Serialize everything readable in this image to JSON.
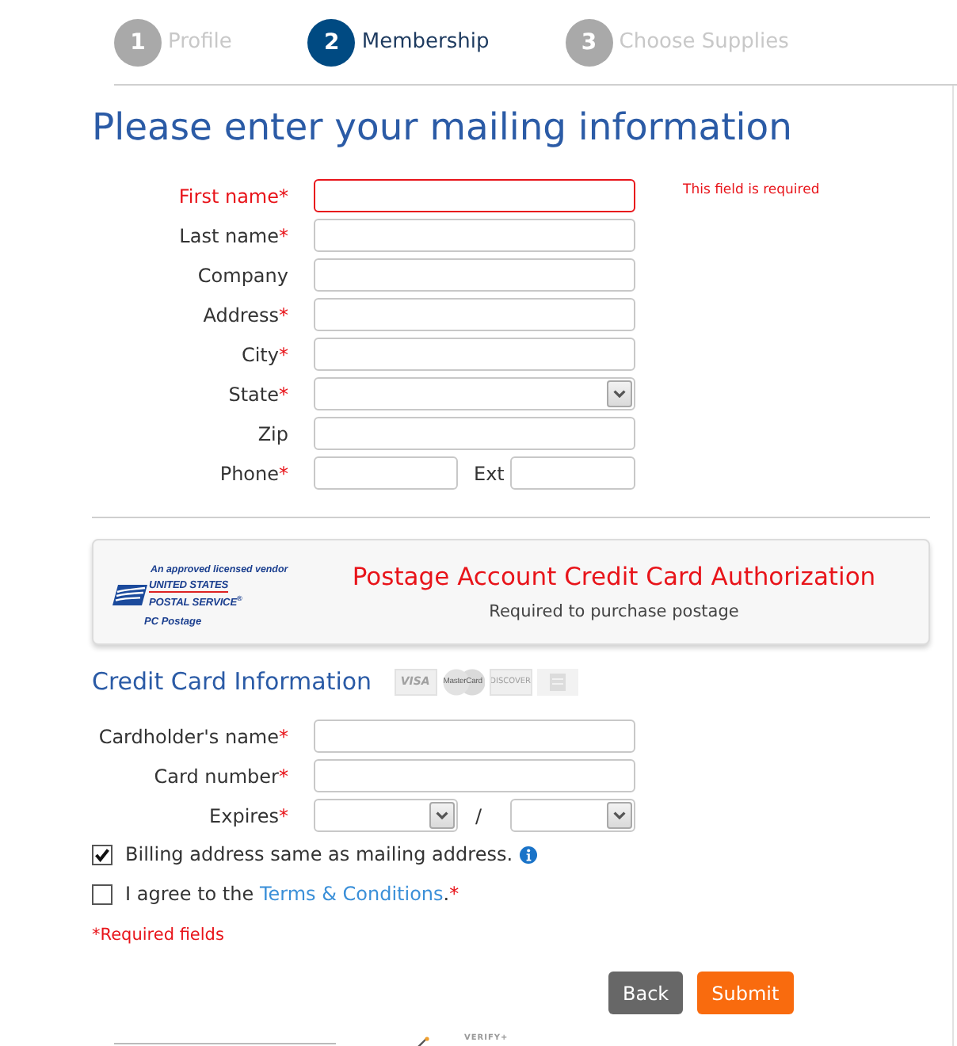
{
  "steps": [
    {
      "number": "1",
      "label": "Profile",
      "selected": false
    },
    {
      "number": "2",
      "label": "Membership",
      "selected": true
    },
    {
      "number": "3",
      "label": "Choose Supplies",
      "selected": false
    }
  ],
  "title": "Please enter your mailing information",
  "mailing_fields": [
    {
      "kind": "text",
      "label": "First name",
      "mark": "*",
      "error": true,
      "error_text": "This field is required"
    },
    {
      "kind": "text",
      "label": "Last name",
      "mark": "*",
      "error": false
    },
    {
      "kind": "text",
      "label": "Company",
      "error": false
    },
    {
      "kind": "text",
      "label": "Address",
      "mark": "*",
      "error": false
    },
    {
      "kind": "text",
      "label": "City",
      "mark": "*",
      "error": false
    },
    {
      "kind": "select",
      "label": "State",
      "mark": "*",
      "error": false
    },
    {
      "kind": "text",
      "label": "Zip",
      "error": false
    },
    {
      "kind": "phone",
      "label": "Phone",
      "mark": "*",
      "ext_label": "Ext",
      "error": false
    }
  ],
  "banner": {
    "vendor_note": "An approved licensed vendor",
    "logo_line_1": "UNITED STATES",
    "logo_line_2": "POSTAL SERVICE$^{®}$",
    "logo_caption": "PC Postage",
    "title": "Postage Account Credit Card Authorization",
    "subtitle": "Required to purchase postage"
  },
  "credit_card": {
    "heading": "Credit Card Information",
    "card_logos": [
      {
        "kind": "wordmark",
        "text": "VISA"
      },
      {
        "kind": "circles",
        "text": "MasterCard"
      },
      {
        "kind": "wordmark",
        "text": "DISCOVER"
      },
      {
        "kind": "plain"
      }
    ],
    "fields": [
      {
        "kind": "text",
        "label": "Cardholder's name",
        "mark": "*",
        "error": false
      },
      {
        "kind": "text",
        "label": "Card number",
        "mark": "*",
        "error": false
      },
      {
        "kind": "expiry",
        "label": "Expires",
        "mark": "*",
        "separator": "/",
        "error": false
      }
    ]
  },
  "checkboxes": [
    {
      "text": "Billing address same as mailing address.",
      "checked": true,
      "info_icon": true
    },
    {
      "text": "I agree to the ",
      "link": "Terms & Conditions",
      "text_after": ".",
      "mark": "*",
      "checked": false,
      "info_icon": false
    }
  ],
  "required_note": "*Required fields",
  "buttons": [
    {
      "label": "Back",
      "kind": "secondary"
    },
    {
      "label": "Submit",
      "kind": "primary"
    }
  ],
  "footer": {
    "badge_text": "VERIFY+"
  }
}
